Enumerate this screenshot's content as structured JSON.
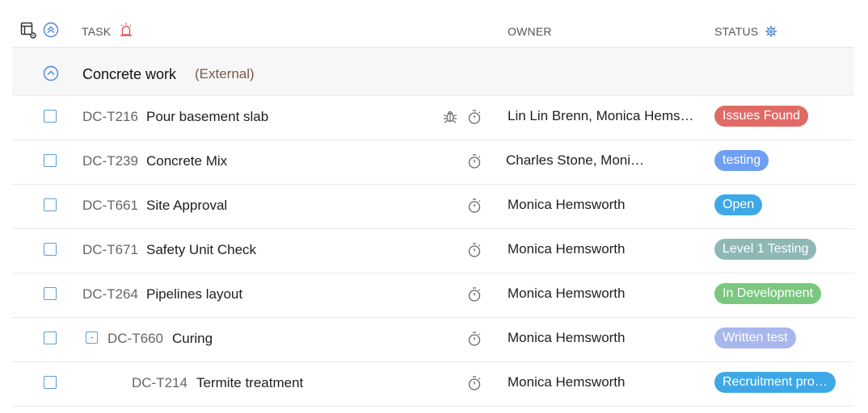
{
  "header": {
    "task_label": "TASK",
    "owner_label": "OWNER",
    "status_label": "STATUS"
  },
  "group": {
    "name": "Concrete work",
    "tag": "(External)"
  },
  "rows": [
    {
      "id": "DC-T216",
      "name": "Pour basement slab",
      "owner": "Lin Lin Brenn, Monica Hems…",
      "status": "Issues Found",
      "status_color": "#e06b66",
      "has_bug": true
    },
    {
      "id": "DC-T239",
      "name": "Concrete Mix",
      "owner": "Charles Stone, Moni…",
      "status": "testing",
      "status_color": "#6f9ff2"
    },
    {
      "id": "DC-T661",
      "name": "Site Approval",
      "owner": "Monica Hemsworth",
      "status": "Open",
      "status_color": "#3ea8e6"
    },
    {
      "id": "DC-T671",
      "name": "Safety Unit Check",
      "owner": "Monica Hemsworth",
      "status": "Level 1 Testing",
      "status_color": "#8eb8b6"
    },
    {
      "id": "DC-T264",
      "name": "Pipelines layout",
      "owner": "Monica Hemsworth",
      "status": "In Development",
      "status_color": "#79c87e"
    },
    {
      "id": "DC-T660",
      "name": "Curing",
      "owner": "Monica Hemsworth",
      "status": "Written test",
      "status_color": "#a8b7ec",
      "collapsible": true
    },
    {
      "id": "DC-T214",
      "name": "Termite treatment",
      "owner": "Monica Hemsworth",
      "status": "Recruitment pro…",
      "status_color": "#3ea8e6",
      "child": true
    }
  ],
  "colors": {
    "accent": "#5a9bdc",
    "alarm": "#e0525a"
  }
}
